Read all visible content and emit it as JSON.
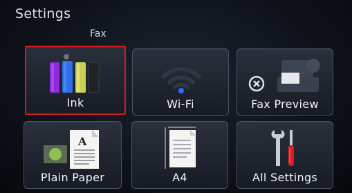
{
  "header": {
    "title": "Settings",
    "subtitle": "Fax"
  },
  "tiles": [
    {
      "label": "Ink",
      "icon": "ink-cartridges-icon",
      "selected": true
    },
    {
      "label": "Wi-Fi",
      "icon": "wifi-icon"
    },
    {
      "label": "Fax Preview",
      "icon": "fax-preview-icon"
    },
    {
      "label": "Plain Paper",
      "icon": "paper-type-icon"
    },
    {
      "label": "A4",
      "icon": "paper-size-icon"
    },
    {
      "label": "All Settings",
      "icon": "tools-icon"
    }
  ],
  "colors": {
    "selection_border": "#d51a1a",
    "ink_black": "#1a1a1a",
    "ink_magenta": "#8e2ad9",
    "ink_cyan": "#2f6ee8",
    "ink_yellow": "#c9cf5a",
    "wifi_dot": "#2a6cff"
  }
}
